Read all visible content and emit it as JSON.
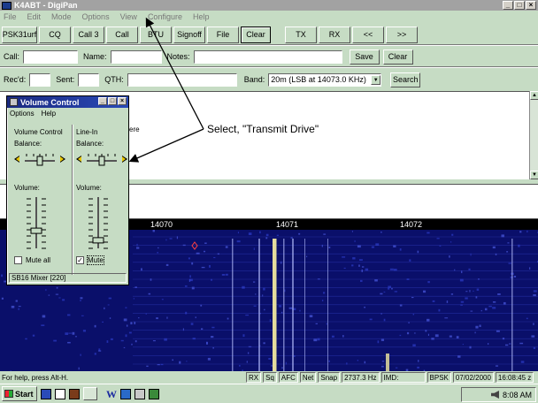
{
  "window": {
    "title": "K4ABT - DigiPan",
    "controls": [
      "_",
      "□",
      "×"
    ]
  },
  "menu": [
    "File",
    "Edit",
    "Mode",
    "Options",
    "View",
    "Configure",
    "Help"
  ],
  "toolbar": [
    "PSK31urf",
    "CQ",
    "Call 3",
    "Call",
    "BTU",
    "Signoff",
    "File",
    "Clear",
    "TX",
    "RX",
    "<<",
    ">>"
  ],
  "row2": {
    "call_label": "Call:",
    "name_label": "Name:",
    "notes_label": "Notes:",
    "save": "Save",
    "clear": "Clear"
  },
  "row3": {
    "recd_label": "Rec'd:",
    "sent_label": "Sent:",
    "qth_label": "QTH:",
    "band_label": "Band:",
    "band_value": "20m (LSB at 14073.0 KHz)",
    "search": "Search"
  },
  "rx_text": {
    "fragment": "ere"
  },
  "waterfall": {
    "scale_labels": [
      "14070",
      "14071",
      "14072"
    ]
  },
  "volume_control": {
    "title": "Volume Control",
    "menu": [
      "Options",
      "Help"
    ],
    "columns": [
      {
        "name": "Volume Control",
        "balance_label": "Balance:",
        "volume_label": "Volume:",
        "mute_label": "Mute all",
        "muted": false,
        "balance": 0.5,
        "volume": 0.35
      },
      {
        "name": "Line-In",
        "balance_label": "Balance:",
        "volume_label": "Volume:",
        "mute_label": "Mute",
        "muted": true,
        "balance": 0.5,
        "volume": 0.15
      }
    ],
    "status": "SB16 Mixer [220]"
  },
  "annotation": {
    "text": "Select, \"Transmit Drive\""
  },
  "statusbar": {
    "help": "For help, press Alt-H.",
    "cells": [
      "RX",
      "Sq",
      "AFC",
      "Net",
      "Snap",
      "2737.3 Hz",
      "IMD:",
      "BPSK",
      "07/02/2000",
      "16:08:45 z"
    ]
  },
  "taskbar": {
    "start": "Start",
    "clock": "8:08 AM"
  },
  "colors": {
    "app_bg": "#c6dcc4",
    "title_active": "#1a2a80",
    "waterfall_bg": "#0a0f6a",
    "signal": "#f0e8a0"
  }
}
